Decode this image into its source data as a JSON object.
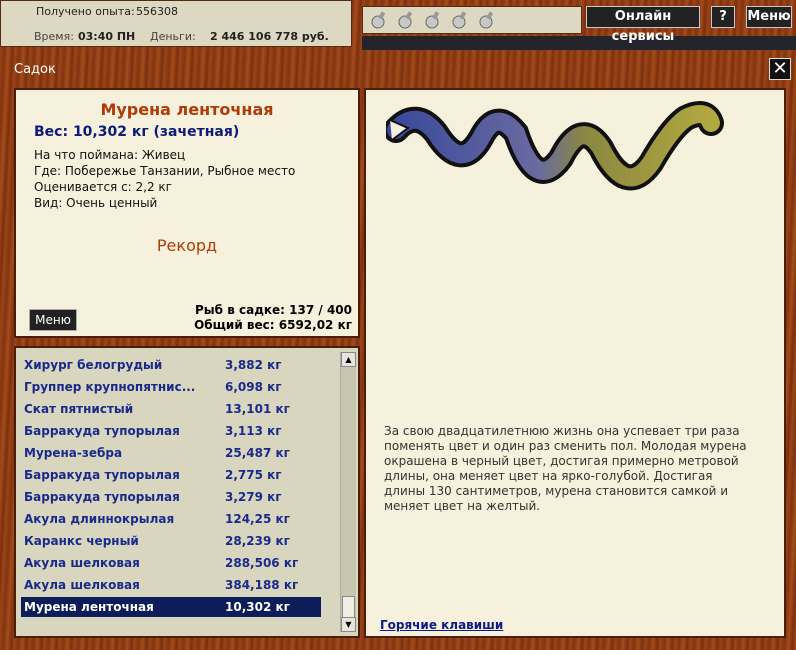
{
  "stats": {
    "exp_label": "Получено опыта:",
    "exp_value": "556308",
    "time_label": "Время:",
    "time_value": "03:40 ПН",
    "money_label": "Деньги:",
    "money_value": "2 446 106 778 руб."
  },
  "toolbar": {
    "online_label": "Онлайн сервисы",
    "help_label": "?",
    "menu_label": "Меню"
  },
  "window": {
    "title": "Садок",
    "close_label": "✕"
  },
  "info": {
    "fish_name": "Мурена ленточная",
    "weight": "Вес: 10,302 кг (зачетная)",
    "details": [
      "На что поймана: Живец",
      "Где: Побережье Танзании, Рыбное место",
      "Оценивается с: 2,2 кг",
      "Вид: Очень ценный"
    ],
    "record_label": "Рекорд",
    "menu_label": "Меню",
    "fish_count": "Рыб в садке: 137 / 400",
    "total_weight": "Общий вес: 6592,02 кг"
  },
  "list": {
    "items": [
      {
        "name": "Хирург белогрудый",
        "weight": "3,882 кг"
      },
      {
        "name": "Группер крупнопятнис...",
        "weight": "6,098 кг"
      },
      {
        "name": "Скат пятнистый",
        "weight": "13,101 кг"
      },
      {
        "name": "Барракуда тупорылая",
        "weight": "3,113 кг"
      },
      {
        "name": "Мурена-зебра",
        "weight": "25,487 кг"
      },
      {
        "name": "Барракуда тупорылая",
        "weight": "2,775 кг"
      },
      {
        "name": "Барракуда тупорылая",
        "weight": "3,279 кг"
      },
      {
        "name": "Акула длиннокрылая",
        "weight": "124,25 кг"
      },
      {
        "name": "Каранкс черный",
        "weight": "28,239 кг"
      },
      {
        "name": "Акула шелковая",
        "weight": "288,506 кг"
      },
      {
        "name": "Акула шелковая",
        "weight": "384,188 кг"
      },
      {
        "name": "Мурена ленточная",
        "weight": "10,302 кг"
      }
    ],
    "selected_index": 11
  },
  "description": "За свою двадцатилетнюю жизнь  она успевает три раза поменять цвет и один раз сменить пол. Молодая мурена окрашена в черный цвет, достигая примерно метровой длины, она меняет цвет на ярко-голубой. Достигая длины 130 сантиметров, мурена становится самкой и меняет цвет на желтый.",
  "hotkeys_label": "Горячие клавиши",
  "colors": {
    "accent": "#b03a08",
    "link": "#0d1a8a",
    "selected_row": "#0c1d5a"
  }
}
